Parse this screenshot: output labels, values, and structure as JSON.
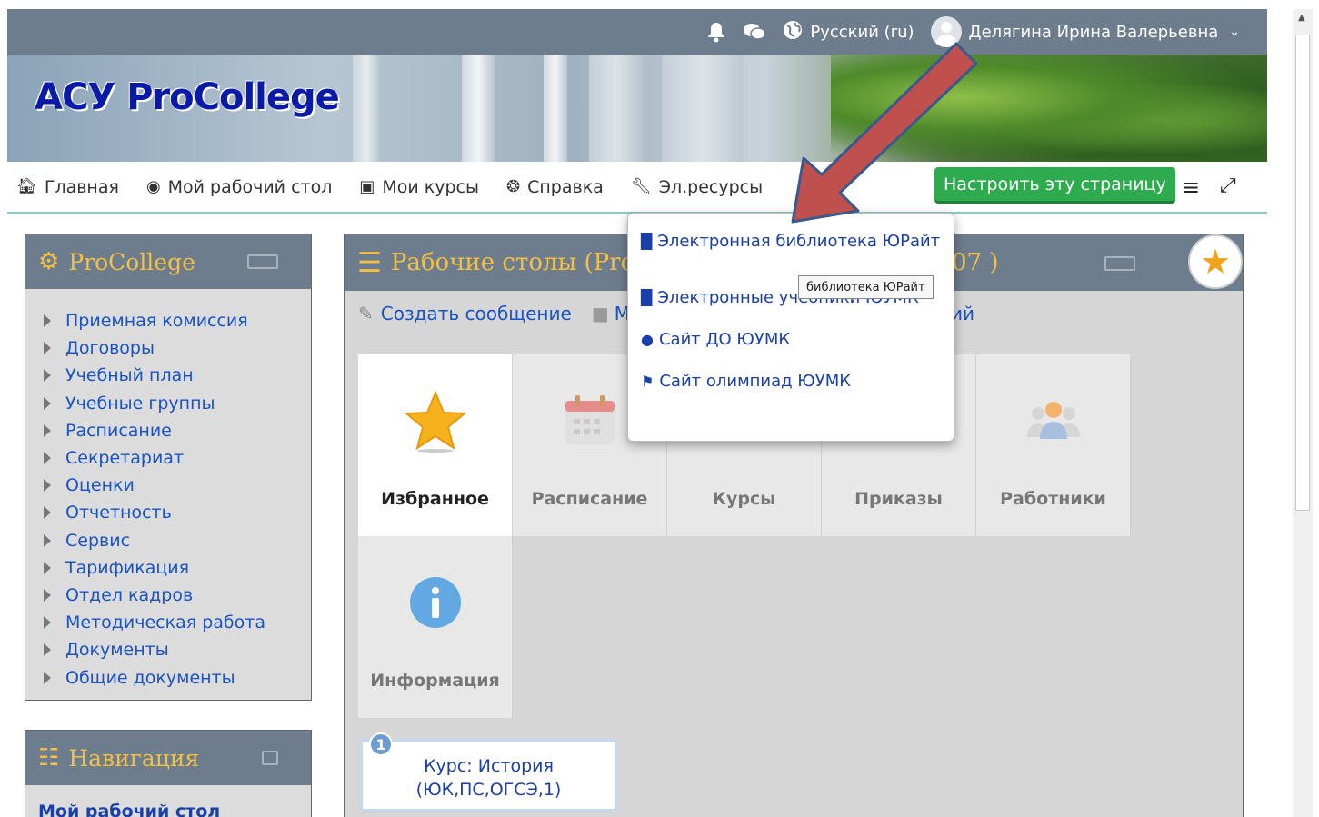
{
  "topbar": {
    "language": "Русский (ru)",
    "user_name": "Делягина Ирина Валерьевна"
  },
  "banner": {
    "logo_text": "АСУ ProCollege"
  },
  "nav": {
    "items": [
      {
        "label": "Главная",
        "icon": "home-icon"
      },
      {
        "label": "Мой рабочий стол",
        "icon": "dashboard-icon"
      },
      {
        "label": "Мои курсы",
        "icon": "briefcase-icon"
      },
      {
        "label": "Справка",
        "icon": "help-icon"
      },
      {
        "label": "Эл.ресурсы",
        "icon": "wrench-icon"
      }
    ],
    "customize_label": "Настроить эту страницу"
  },
  "procollege_block": {
    "title": "ProCollege",
    "items": [
      "Приемная комиссия",
      "Договоры",
      "Учебный план",
      "Учебные группы",
      "Расписание",
      "Секретариат",
      "Оценки",
      "Отчетность",
      "Сервис",
      "Тарификация",
      "Отдел кадров",
      "Методическая работа",
      "Документы",
      "Общие документы"
    ]
  },
  "navigation_block": {
    "title": "Навигация",
    "first_item": "Мой рабочий стол"
  },
  "main": {
    "title_left": "Рабочие столы (Pro",
    "title_right": "07 )",
    "actions": {
      "create_message": "Создать сообщение",
      "folder_partial": "М",
      "trailing_partial": "ий"
    },
    "tiles": [
      {
        "label": "Избранное",
        "icon": "star-icon"
      },
      {
        "label": "Расписание",
        "icon": "calendar-icon"
      },
      {
        "label": "Курсы",
        "icon": "courses-icon"
      },
      {
        "label": "Приказы",
        "icon": "orders-icon"
      },
      {
        "label": "Работники",
        "icon": "people-icon"
      },
      {
        "label": "Информация",
        "icon": "info-icon"
      }
    ],
    "course_card": {
      "badge": "1",
      "line1": "Курс: История",
      "line2": "(ЮК,ПС,ОГСЭ,1)"
    }
  },
  "dropdown": {
    "items": [
      {
        "label": "Электронная библиотека ЮРайт",
        "icon": "book-icon"
      },
      {
        "label": "Электронные учебники ЮУМК",
        "icon": "book-icon"
      },
      {
        "label": "Сайт ДО ЮУМК",
        "icon": "globe-icon"
      },
      {
        "label": "Сайт олимпиад ЮУМК",
        "icon": "flag-icon"
      }
    ],
    "tooltip": "библиотека ЮРайт"
  },
  "colors": {
    "header_bg": "#6d7d8d",
    "accent_yellow": "#f4c043",
    "link_blue": "#1a53c5",
    "customize_green": "#2eab4f",
    "arrow_red": "#c0504d"
  }
}
